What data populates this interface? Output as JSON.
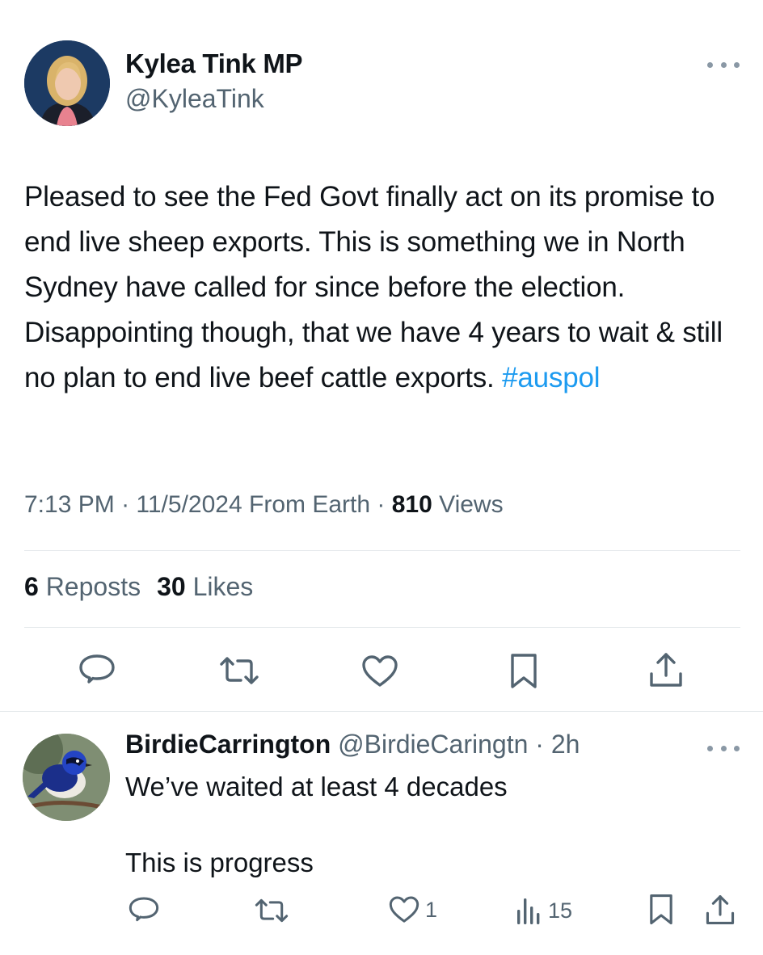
{
  "tweet": {
    "author": {
      "name": "Kylea Tink MP",
      "handle": "@KyleaTink"
    },
    "text": "Pleased to see the Fed Govt finally act on its promise to end live sheep exports. This is something we in North Sydney have called for since before the election. Disappointing though, that we have 4 years to wait & still no plan to end live beef cattle exports.",
    "hashtag": "#auspol",
    "time": "7:13 PM",
    "date": "11/5/2024",
    "source": "From Earth",
    "views_count": "810",
    "views_label": "Views",
    "reposts_count": "6",
    "reposts_label": "Reposts",
    "likes_count": "30",
    "likes_label": "Likes",
    "actions": [
      "reply-icon",
      "repost-icon",
      "like-icon",
      "bookmark-icon",
      "share-icon"
    ]
  },
  "reply": {
    "name": "BirdieCarrington",
    "handle": "@BirdieCaringtn",
    "time": "2h",
    "text": "We’ve waited at least 4 decades\n\nThis is progress",
    "like_count": "1",
    "views_count": "15",
    "actions": [
      "reply-icon",
      "repost-icon",
      "like-icon",
      "views-icon",
      "bookmark-icon",
      "share-icon"
    ]
  },
  "colors": {
    "text": "#0f1419",
    "secondary": "#536471",
    "link": "#1d9bf0",
    "divider": "#e4e8eb"
  }
}
